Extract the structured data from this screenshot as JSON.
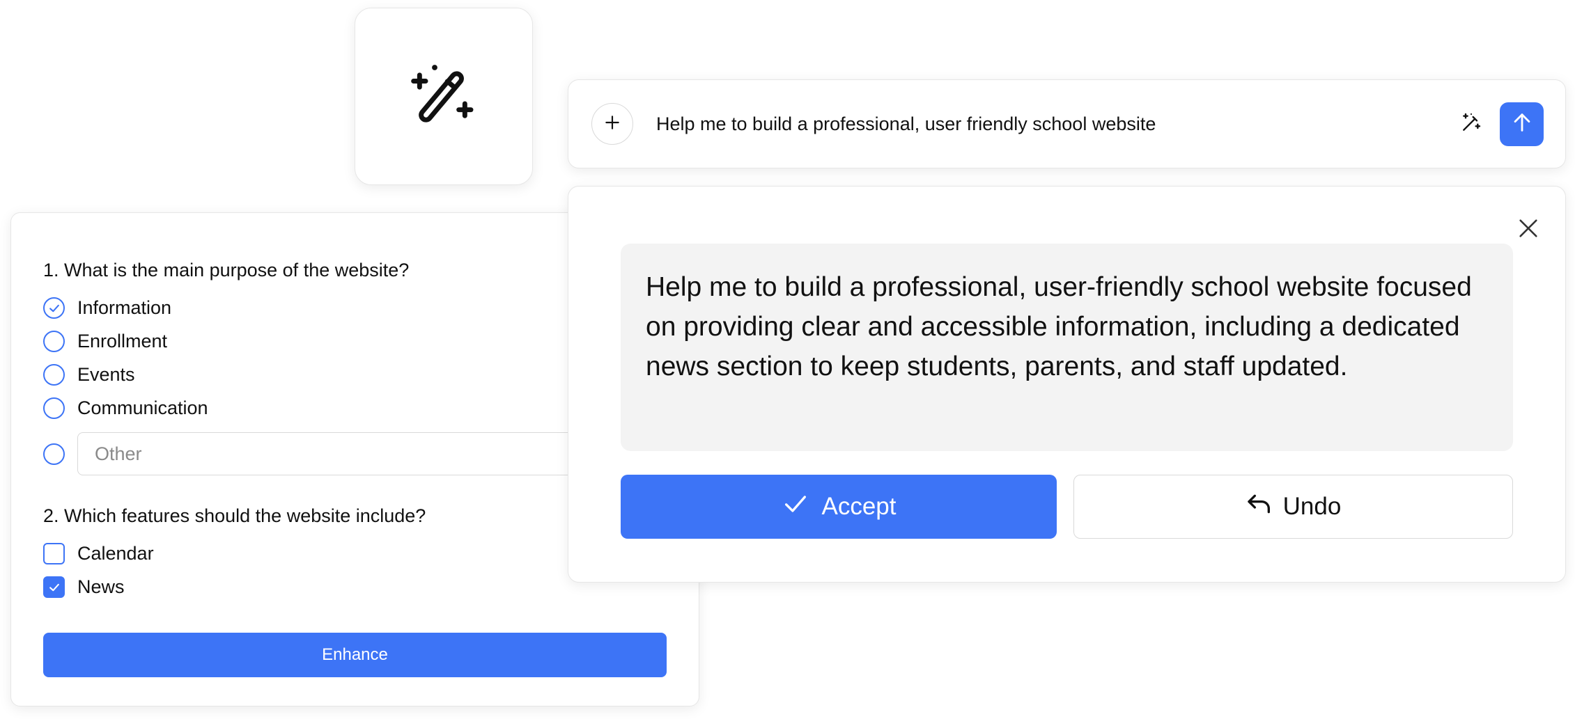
{
  "icons": {
    "magic_tile": "magic-wand-icon",
    "plus": "plus-icon",
    "enhance": "magic-wand-icon",
    "send": "arrow-up-icon",
    "close": "close-icon",
    "accept": "check-icon",
    "undo": "undo-icon"
  },
  "colors": {
    "accent": "#3d74f6",
    "enhanced_bg": "#f3f3f3"
  },
  "prompt_bar": {
    "text": "Help me to build a professional, user friendly school website"
  },
  "survey": {
    "q1": {
      "title": "1. What is the main purpose of the website?",
      "options": [
        {
          "label": "Information",
          "checked": true
        },
        {
          "label": "Enrollment",
          "checked": false
        },
        {
          "label": "Events",
          "checked": false
        },
        {
          "label": "Communication",
          "checked": false
        }
      ],
      "other_placeholder": "Other"
    },
    "q2": {
      "title": "2. Which features should the website include?",
      "options": [
        {
          "label": "Calendar",
          "checked": false
        },
        {
          "label": "News",
          "checked": true
        }
      ]
    },
    "enhance_label": "Enhance"
  },
  "dialog": {
    "enhanced_text": "Help me to build a professional, user-friendly school website focused on providing clear and accessible information, including a dedicated news section to keep students, parents, and staff updated.",
    "accept_label": "Accept",
    "undo_label": "Undo"
  }
}
